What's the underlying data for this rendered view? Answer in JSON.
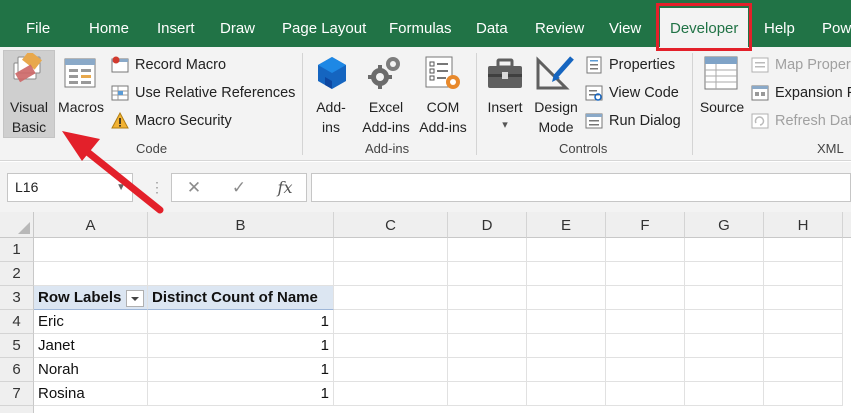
{
  "tabs": [
    {
      "label": "File"
    },
    {
      "label": "Home"
    },
    {
      "label": "Insert"
    },
    {
      "label": "Draw"
    },
    {
      "label": "Page Layout"
    },
    {
      "label": "Formulas"
    },
    {
      "label": "Data"
    },
    {
      "label": "Review"
    },
    {
      "label": "View"
    },
    {
      "label": "Developer",
      "active": true
    },
    {
      "label": "Help"
    },
    {
      "label": "Pow"
    }
  ],
  "ribbon": {
    "code": {
      "visual_basic_line1": "Visual",
      "visual_basic_line2": "Basic",
      "macros": "Macros",
      "record_macro": "Record Macro",
      "use_relative_references": "Use Relative References",
      "macro_security": "Macro Security",
      "group_label": "Code"
    },
    "addins": {
      "addins_line1": "Add-",
      "addins_line2": "ins",
      "excel_addins_line1": "Excel",
      "excel_addins_line2": "Add-ins",
      "com_addins_line1": "COM",
      "com_addins_line2": "Add-ins",
      "group_label": "Add-ins"
    },
    "controls": {
      "insert": "Insert",
      "insert_dropdown": "▾",
      "design_mode_line1": "Design",
      "design_mode_line2": "Mode",
      "properties": "Properties",
      "view_code": "View Code",
      "run_dialog": "Run Dialog",
      "group_label": "Controls"
    },
    "xml": {
      "source": "Source",
      "map_properties": "Map Proper",
      "expansion_packs": "Expansion P",
      "refresh_data": "Refresh Dat",
      "group_label": "XML"
    }
  },
  "formula_bar": {
    "name_box": "L16",
    "cancel_symbol": "✕",
    "enter_symbol": "✓",
    "fx_symbol": "fx",
    "formula": ""
  },
  "sheet": {
    "columns": [
      "A",
      "B",
      "C",
      "D",
      "E",
      "F",
      "G",
      "H"
    ],
    "rows": [
      "1",
      "2",
      "3",
      "4",
      "5",
      "6",
      "7"
    ],
    "pivot_header_row_labels": "Row Labels",
    "pivot_header_value": "Distinct Count of Name",
    "pivot_rows": [
      {
        "label": "Eric",
        "value": "1"
      },
      {
        "label": "Janet",
        "value": "1"
      },
      {
        "label": "Norah",
        "value": "1"
      },
      {
        "label": "Rosina",
        "value": "1"
      }
    ]
  },
  "colors": {
    "ribbon_green": "#217346",
    "highlight_red": "#e3202a",
    "pivot_header_blue": "#dce6f2"
  }
}
